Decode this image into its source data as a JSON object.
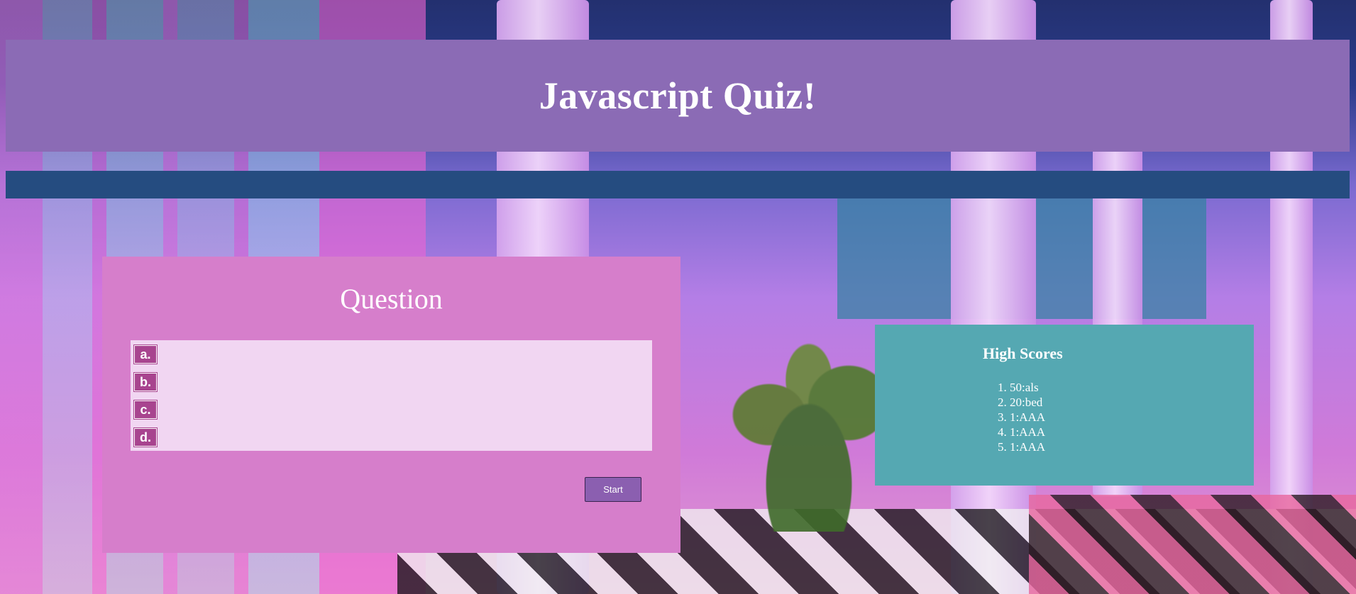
{
  "header": {
    "title": "Javascript Quiz!"
  },
  "quiz": {
    "question": "Question",
    "answers": [
      {
        "label": "a.",
        "text": ""
      },
      {
        "label": "b.",
        "text": ""
      },
      {
        "label": "c.",
        "text": ""
      },
      {
        "label": "d.",
        "text": ""
      }
    ],
    "start_label": "Start"
  },
  "high_scores": {
    "title": "High Scores",
    "entries": [
      "50:als",
      "20:bed",
      "1:AAA",
      "1:AAA",
      "1:AAA"
    ]
  },
  "colors": {
    "header_bg": "#8b6bb5",
    "subbar_bg": "#254c80",
    "quiz_bg": "#d67ecb",
    "answers_bg": "#f1d6f2",
    "choice_label_bg": "#a8448f",
    "start_button_bg": "#8b5fb0",
    "scores_bg": "#55a8b2"
  }
}
